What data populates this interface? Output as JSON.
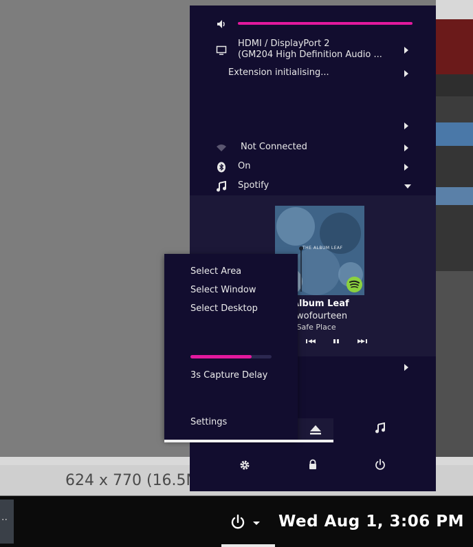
{
  "background": {
    "statusbar_text": "624 x 770 (16.5M"
  },
  "taskbar": {
    "left_thumb_text": "..",
    "clock": "Wed Aug  1,  3:06 PM",
    "power_icon": "power-icon"
  },
  "panel": {
    "volume": {
      "icon": "speaker-icon",
      "level": 1.0
    },
    "output": {
      "line1": "HDMI / DisplayPort 2",
      "line2": "(GM204 High Definition Audio ..."
    },
    "extension": "Extension initialising...",
    "network": {
      "label": "Not Connected",
      "icon": "wifi-icon"
    },
    "bluetooth": {
      "label": "On",
      "icon": "bluetooth-icon"
    },
    "spotify": {
      "label": "Spotify",
      "icon": "music-note-icon"
    },
    "media": {
      "art_label": "THE ALBUM LEAF",
      "title": "he Album Leaf",
      "artist": "ntytwofourteen",
      "album": "a Safe Place"
    }
  },
  "screenshot_menu": {
    "items": [
      "Select Area",
      "Select Window",
      "Select Desktop"
    ],
    "delay_label": "3s Capture Delay",
    "delay_level": 0.75,
    "settings_label": "Settings"
  },
  "colors": {
    "accent": "#e3199e",
    "panel_bg": "#120d2f",
    "media_bg": "#1c1838"
  }
}
